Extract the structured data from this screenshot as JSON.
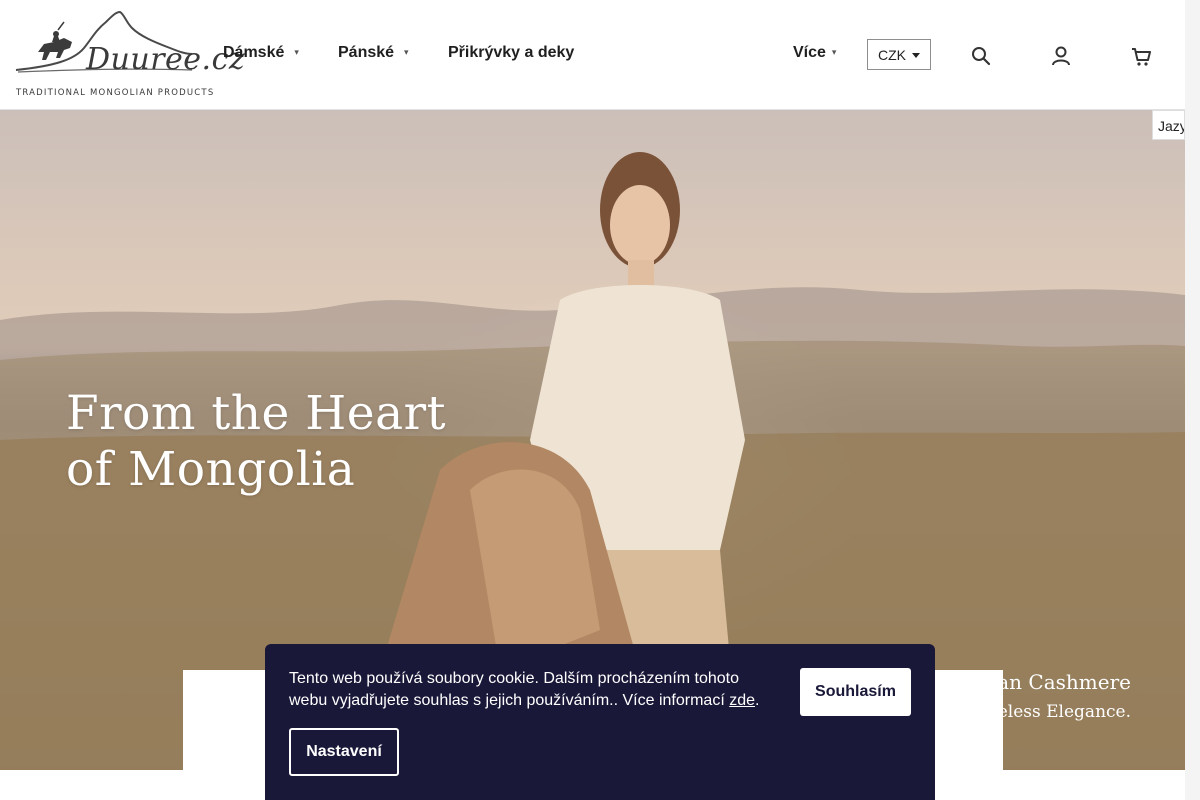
{
  "logo": {
    "wordmark": "Duuree.cz",
    "tagline": "TRADITIONAL MONGOLIAN PRODUCTS",
    "icon": "horse-rider-mountain-logo"
  },
  "nav": {
    "items": [
      {
        "label": "Dámské",
        "has_submenu": true
      },
      {
        "label": "Pánské",
        "has_submenu": true
      },
      {
        "label": "Přikrývky a deky",
        "has_submenu": false
      }
    ],
    "more_label": "Více"
  },
  "currency": {
    "selected": "CZK"
  },
  "header_icons": [
    "search-icon",
    "user-icon",
    "cart-icon"
  ],
  "language_tab": {
    "label": "Jazyk"
  },
  "hero": {
    "title_line1": "From the Heart",
    "title_line2": "of Mongolia",
    "tagline_line1": "lian Cashmere",
    "tagline_line2": "imeless Elegance."
  },
  "cookie_bar": {
    "text": "Tento web používá soubory cookie. Dalším procházením tohoto webu vyjadřujete souhlas s jejich používáním.. Více informací ",
    "link_label": "zde",
    "after_link": ".",
    "accept_label": "Souhlasím",
    "settings_label": "Nastavení"
  },
  "colors": {
    "cookie_bg": "#191838",
    "text_dark": "#1f1f1f",
    "white": "#ffffff"
  }
}
